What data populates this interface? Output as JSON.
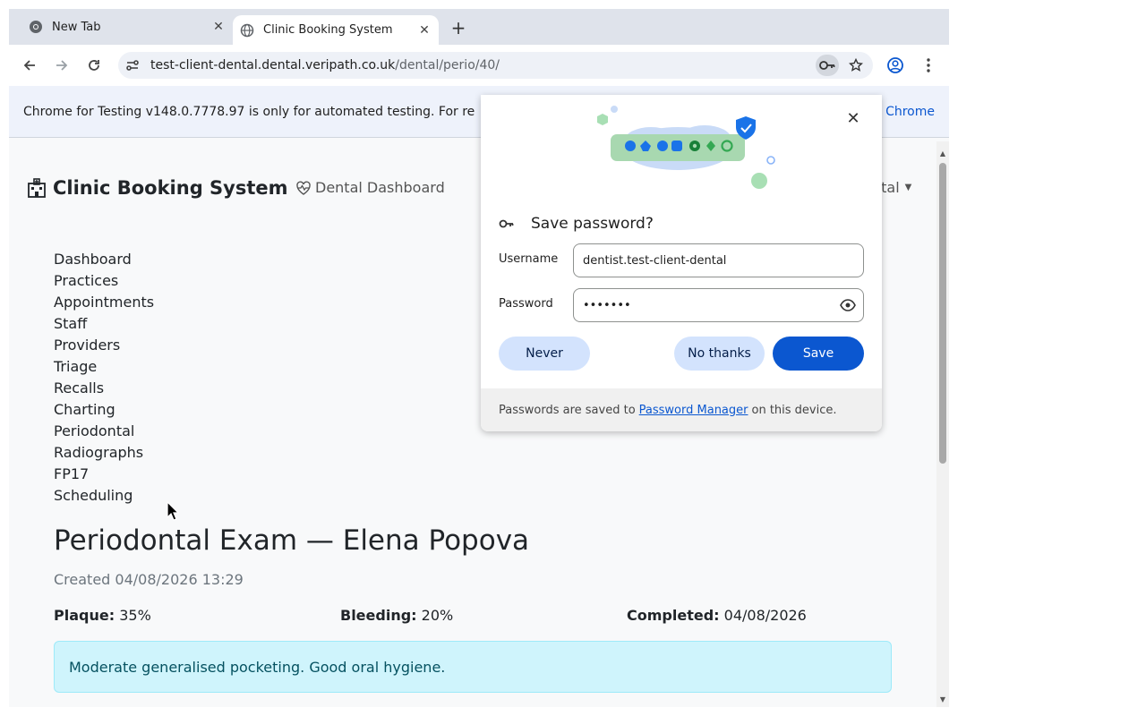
{
  "browser": {
    "tabs": [
      {
        "title": "New Tab",
        "active": false
      },
      {
        "title": "Clinic Booking System",
        "active": true
      }
    ],
    "url_host": "test-client-dental.dental.veripath.co.uk",
    "url_path": "/dental/perio/40/",
    "infobar": {
      "text": "Chrome for Testing v148.0.7778.97 is only for automated testing. For re",
      "link": "d Chrome"
    }
  },
  "app": {
    "brand": "Clinic Booking System",
    "nav_link": "Dental Dashboard",
    "user_menu": "ntal",
    "sidebar": [
      {
        "label": "Dashboard"
      },
      {
        "label": "Practices"
      },
      {
        "label": "Appointments"
      },
      {
        "label": "Staff"
      },
      {
        "label": "Providers"
      },
      {
        "label": "Triage"
      },
      {
        "label": "Recalls"
      },
      {
        "label": "Charting"
      },
      {
        "label": "Periodontal"
      },
      {
        "label": "Radiographs"
      },
      {
        "label": "FP17"
      },
      {
        "label": "Scheduling"
      }
    ],
    "page_title": "Periodontal Exam — Elena Popova",
    "created": "Created 04/08/2026 13:29",
    "stats": {
      "plaque_label": "Plaque:",
      "plaque_value": "35%",
      "bleeding_label": "Bleeding:",
      "bleeding_value": "20%",
      "completed_label": "Completed:",
      "completed_value": "04/08/2026"
    },
    "note": "Moderate generalised pocketing. Good oral hygiene."
  },
  "password_bubble": {
    "title": "Save password?",
    "username_label": "Username",
    "username_value": "dentist.test-client-dental",
    "password_label": "Password",
    "password_value": "•••••••",
    "never_label": "Never",
    "no_thanks_label": "No thanks",
    "save_label": "Save",
    "footer_prefix": "Passwords are saved to",
    "footer_link": "Password Manager",
    "footer_suffix": "on this device."
  },
  "colors": {
    "accent": "#0b57d0",
    "tonal": "#d3e3fd",
    "alert_bg": "#cff4fc",
    "alert_text": "#055160"
  }
}
